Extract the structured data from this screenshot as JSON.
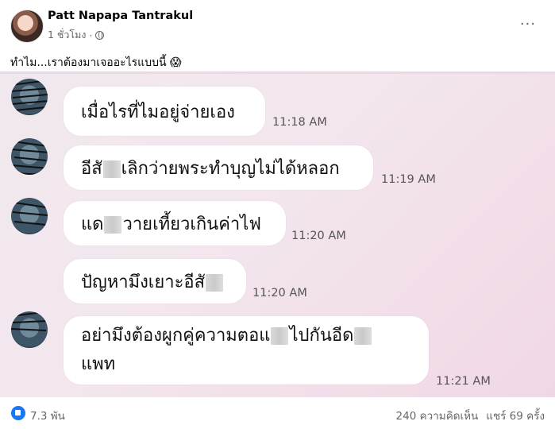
{
  "post": {
    "author": "Patt Napapa Tantrakul",
    "time": "1 ชั่วโมง",
    "dot": "·",
    "more": "···",
    "caption": "ทำไม...เราต้องมาเจออะไรแบบนี้ 😱"
  },
  "chat": {
    "messages": [
      {
        "pre": "เมื่อไรที่ไมอยู่จ่ายเอง",
        "post": "",
        "time": "11:18 AM"
      },
      {
        "pre": "อีสั",
        "post": "เลิกว่ายพระทำบุญไม่ได้หลอก",
        "time": "11:19 AM"
      },
      {
        "pre": "แด",
        "post": "วายเที้ยวเกินค่าไฟ",
        "time": "11:20 AM"
      },
      {
        "pre": "ปัญหามึงเยาะอีสั",
        "post": "",
        "time": "11:20 AM"
      },
      {
        "pre": "อย่ามึงต้องผูกคู่ความตอแ",
        "post": "ไปกันอีด",
        "line2": "แพท",
        "time": "11:21 AM"
      }
    ]
  },
  "footer": {
    "likes": "7.3 พัน",
    "comments": "240 ความคิดเห็น",
    "shares": "แชร์ 69 ครั้ง"
  },
  "colors": {
    "accent": "#1877f2",
    "chat_bg": "#f1e4ec"
  },
  "icons": {
    "reaction": "like-icon",
    "privacy": "globe-icon",
    "menu": "more-icon"
  }
}
